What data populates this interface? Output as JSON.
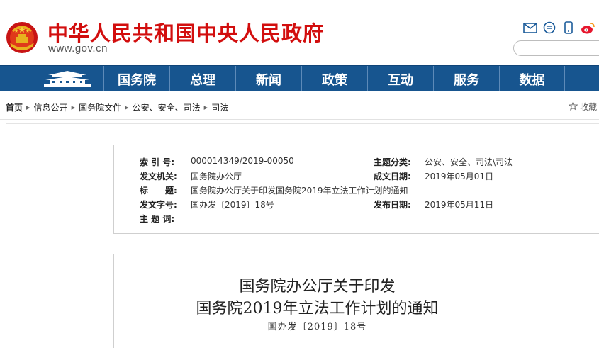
{
  "header": {
    "site_title": "中华人民共和国中央人民政府",
    "site_url": "www.gov.cn",
    "search_placeholder": ""
  },
  "nav": {
    "items": [
      "国务院",
      "总理",
      "新闻",
      "政策",
      "互动",
      "服务",
      "数据"
    ]
  },
  "breadcrumb": {
    "items": [
      "首页",
      "信息公开",
      "国务院文件",
      "公安、安全、司法",
      "司法"
    ],
    "favorite_label": "收藏"
  },
  "info": {
    "index_label": "索 引 号:",
    "index_value": "000014349/2019-00050",
    "category_label": "主题分类:",
    "category_value": "公安、安全、司法\\司法",
    "issuer_label": "发文机关:",
    "issuer_value": "国务院办公厅",
    "date_label": "成文日期:",
    "date_value": "2019年05月01日",
    "title_label": "标　　题:",
    "title_value": "国务院办公厅关于印发国务院2019年立法工作计划的通知",
    "docnum_label": "发文字号:",
    "docnum_value": "国办发〔2019〕18号",
    "publish_label": "发布日期:",
    "publish_value": "2019年05月11日",
    "keywords_label": "主 题 词:",
    "keywords_value": ""
  },
  "document": {
    "title_line1": "国务院办公厅关于印发",
    "title_line2": "国务院2019年立法工作计划的通知",
    "doc_number": "国办发〔2019〕18号"
  },
  "colors": {
    "brand_red": "#d20e0e",
    "nav_blue": "#17558f"
  }
}
